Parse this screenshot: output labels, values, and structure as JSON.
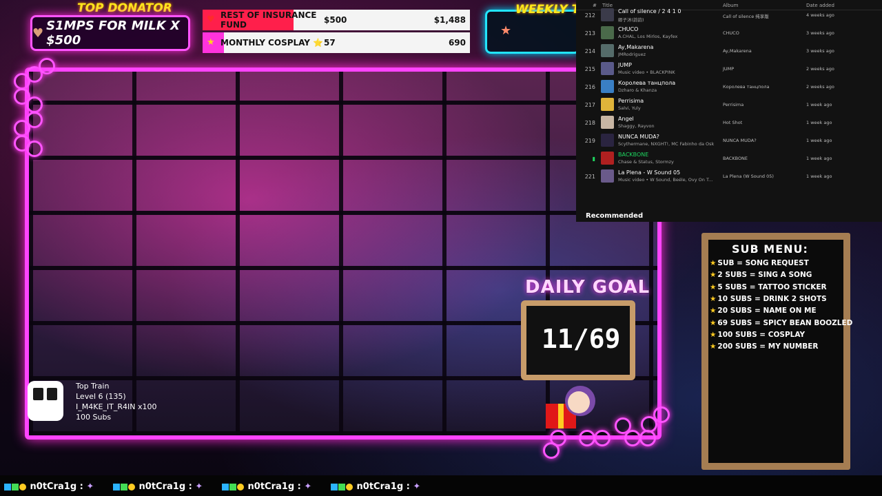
{
  "top_donator": {
    "title": "TOP DONATOR",
    "entry": "S1MPS FOR MILK X $500",
    "icon": "heart-icon"
  },
  "weekly_top": {
    "title": "WEEKLY TOP",
    "icon": "star-icon"
  },
  "goals": [
    {
      "label": "REST OF INSURANCE FUND",
      "current": "$500",
      "target": "$1,488",
      "fill_fraction": 0.34,
      "fill_color": "#ff1f4b",
      "icon": "heart-icon"
    },
    {
      "label": "MONTHLY COSPLAY ⭐",
      "current": "57",
      "target": "690",
      "fill_fraction": 0.08,
      "fill_color": "#ff33dd",
      "icon": "star-icon"
    }
  ],
  "playlist": {
    "headers": {
      "num": "#",
      "title": "Title",
      "album": "Album",
      "date": "Date added"
    },
    "tracks": [
      {
        "num": "212",
        "title": "Call of silence / 2 4 1 0",
        "artist": "卿子沐(韵韵)",
        "album": "Call of silence 纯享版",
        "date": "4 weeks ago"
      },
      {
        "num": "213",
        "title": "CHUCO",
        "artist": "A.CHAL, Los Mirlos, Kayfex",
        "album": "CHUCO",
        "date": "3 weeks ago"
      },
      {
        "num": "214",
        "title": "Ay,Makarena",
        "artist": "JMRodriguez",
        "album": "Ay,Makarena",
        "date": "3 weeks ago"
      },
      {
        "num": "215",
        "title": "JUMP",
        "artist": "Music video • BLACKPINK",
        "album": "JUMP",
        "date": "2 weeks ago"
      },
      {
        "num": "216",
        "title": "Королева танцпола",
        "artist": "Dzharo & Khanza",
        "album": "Королева танцпола",
        "date": "2 weeks ago"
      },
      {
        "num": "217",
        "title": "Perrisima",
        "artist": "Salvi, Yuly",
        "album": "Perrisima",
        "date": "1 week ago"
      },
      {
        "num": "218",
        "title": "Angel",
        "artist": "Shaggy, Rayvon",
        "album": "Hot Shot",
        "date": "1 week ago"
      },
      {
        "num": "219",
        "title": "NUNCA MUDA?",
        "artist": "Scythermane, NXGHT!, MC Fabinho da Osk",
        "album": "NUNCA MUDA?",
        "date": "1 week ago"
      },
      {
        "num": "",
        "title": "BACKBONE",
        "artist": "Chase & Status, Stormzy",
        "album": "BACKBONE",
        "date": "1 week ago",
        "playing": true
      },
      {
        "num": "221",
        "title": "La Plena - W Sound 05",
        "artist": "Music video • W Sound, Beéle, Ovy On T...",
        "album": "La Plena (W Sound 05)",
        "date": "1 week ago"
      }
    ],
    "recommended_label": "Recommended"
  },
  "sub_menu": {
    "title": "SUB MENU:",
    "items": [
      "SUB = SONG REQUEST",
      "2 SUBS = SING A SONG",
      "5 SUBS = TATTOO STICKER",
      "10 SUBS = DRINK 2 SHOTS",
      "20 SUBS = NAME ON ME",
      "69 SUBS = SPICY BEAN BOOZLED",
      "100 SUBS = COSPLAY",
      "200 SUBS = MY NUMBER"
    ]
  },
  "daily_goal": {
    "title": "DAILY GOAL",
    "value": "11/69"
  },
  "top_train": {
    "title": "Top Train",
    "level": "Level 6  (135)",
    "user": "I_M4KE_IT_R4IN x100",
    "subs": "100 Subs",
    "icon": "train-icon"
  },
  "chat_ticker": {
    "entries": [
      {
        "user": "n0tCra1g",
        "sep": ":"
      },
      {
        "user": "n0tCra1g",
        "sep": ":"
      },
      {
        "user": "n0tCra1g",
        "sep": ":"
      },
      {
        "user": "n0tCra1g",
        "sep": ":"
      }
    ]
  }
}
